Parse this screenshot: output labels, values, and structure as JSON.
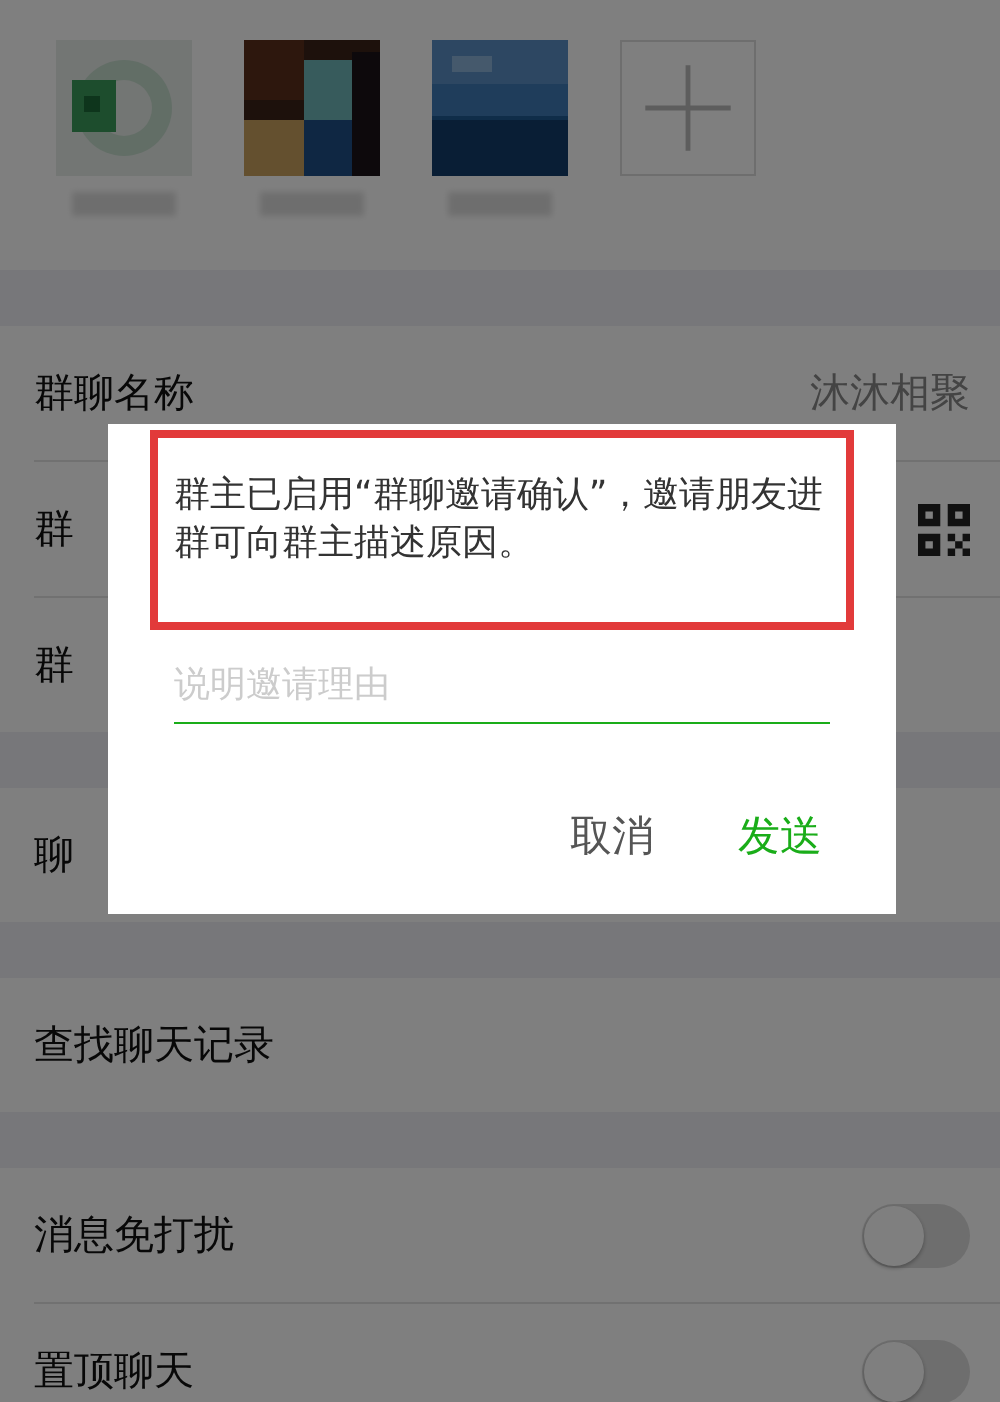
{
  "members": [
    {
      "kind": "picture"
    },
    {
      "kind": "picture"
    },
    {
      "kind": "picture"
    },
    {
      "kind": "add"
    }
  ],
  "sections": [
    {
      "items": [
        {
          "kind": "value",
          "label": "群聊名称",
          "value": "沐沐相聚"
        },
        {
          "kind": "qr",
          "label": "群"
        },
        {
          "kind": "plain",
          "label": "群"
        }
      ]
    },
    {
      "items": [
        {
          "kind": "plain",
          "label": "聊"
        }
      ]
    },
    {
      "items": [
        {
          "kind": "plain",
          "label": "查找聊天记录"
        }
      ]
    },
    {
      "items": [
        {
          "kind": "toggle",
          "label": "消息免打扰",
          "on": false
        },
        {
          "kind": "toggle",
          "label": "置顶聊天",
          "on": false
        }
      ]
    }
  ],
  "dialog": {
    "message": "群主已启用“群聊邀请确认”，邀请朋友进群可向群主描述原因。",
    "highlighted": true,
    "placeholder": "说明邀请理由",
    "buttons": [
      {
        "label": "取消",
        "primary": false
      },
      {
        "label": "发送",
        "primary": true
      }
    ]
  }
}
